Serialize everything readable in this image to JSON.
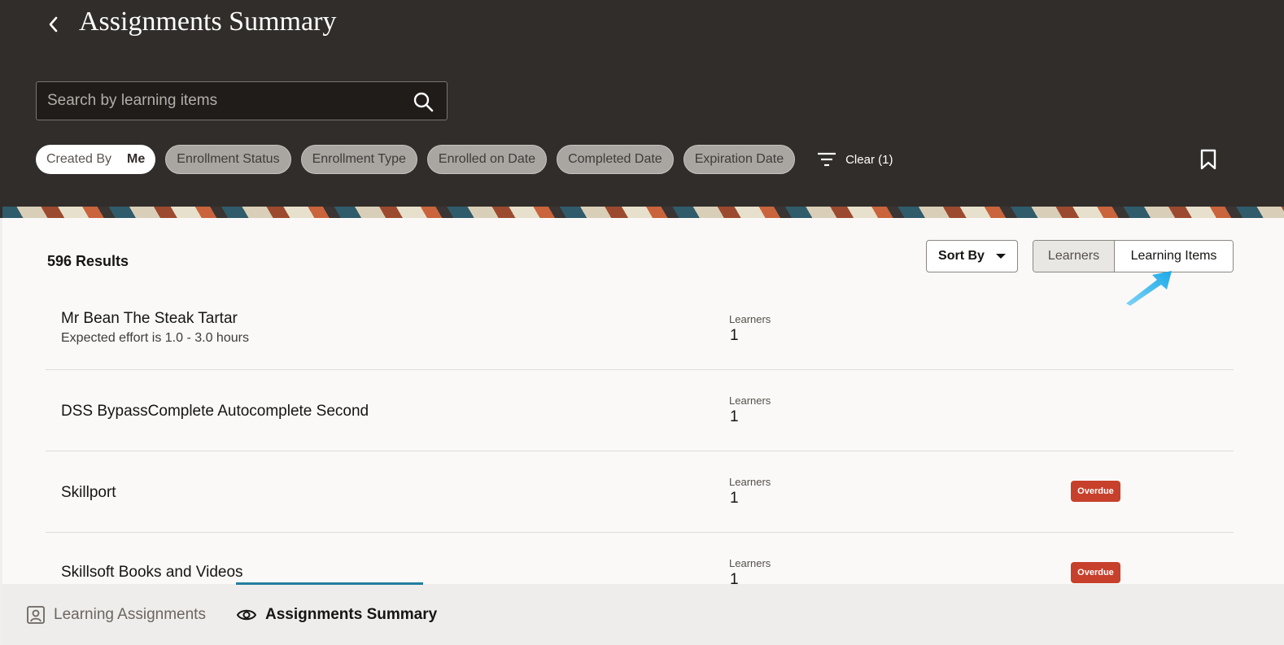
{
  "header": {
    "title": "Assignments Summary",
    "search": {
      "placeholder": "Search by learning items",
      "value": ""
    },
    "chips": [
      {
        "label": "Created By",
        "value": "Me"
      },
      {
        "label": "Enrollment Status"
      },
      {
        "label": "Enrollment Type"
      },
      {
        "label": "Enrolled on Date"
      },
      {
        "label": "Completed Date"
      },
      {
        "label": "Expiration Date"
      }
    ],
    "clear_label": "Clear (1)"
  },
  "results": {
    "count_label": "596 Results",
    "sort_label": "Sort By",
    "view_toggle": {
      "options": [
        "Learners",
        "Learning Items"
      ],
      "selected": "Learning Items"
    }
  },
  "items": [
    {
      "title": "Mr Bean The Steak Tartar",
      "subtitle": "Expected effort is 1.0 - 3.0 hours",
      "learners_label": "Learners",
      "learners": "1",
      "badge": ""
    },
    {
      "title": "DSS BypassComplete Autocomplete Second",
      "subtitle": "",
      "learners_label": "Learners",
      "learners": "1",
      "badge": ""
    },
    {
      "title": "Skillport",
      "subtitle": "",
      "learners_label": "Learners",
      "learners": "1",
      "badge": "Overdue"
    },
    {
      "title": "Skillsoft Books and Videos",
      "subtitle": "",
      "learners_label": "Learners",
      "learners": "1",
      "badge": "Overdue"
    }
  ],
  "bottom_nav": {
    "items": [
      {
        "label": "Learning Assignments",
        "icon": "person-card-icon"
      },
      {
        "label": "Assignments Summary",
        "icon": "eye-icon",
        "active": true
      }
    ]
  },
  "colors": {
    "header_bg": "#312d2a",
    "badge_overdue": "#c7402c",
    "active_underline": "#227e9e",
    "pointer_arrow": "#1ba9e8"
  }
}
